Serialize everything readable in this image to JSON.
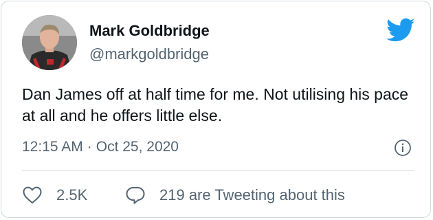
{
  "tweet": {
    "author_name": "Mark Goldbridge",
    "author_handle": "@markgoldbridge",
    "text": "Dan James off at half time for me. Not utilising his pace at all and he offers little else.",
    "time": "12:15 AM",
    "separator": "·",
    "date": "Oct 25, 2020"
  },
  "actions": {
    "like_count": "2.5K",
    "reply_label": "219 are Tweeting about this"
  },
  "icons": {
    "brand": "twitter-bird-icon",
    "info": "info-icon",
    "like": "heart-icon",
    "reply": "speech-bubble-icon"
  },
  "colors": {
    "brand_blue": "#1d9bf0",
    "text_primary": "#0f1419",
    "text_secondary": "#536471",
    "divider": "#cfd9de"
  }
}
